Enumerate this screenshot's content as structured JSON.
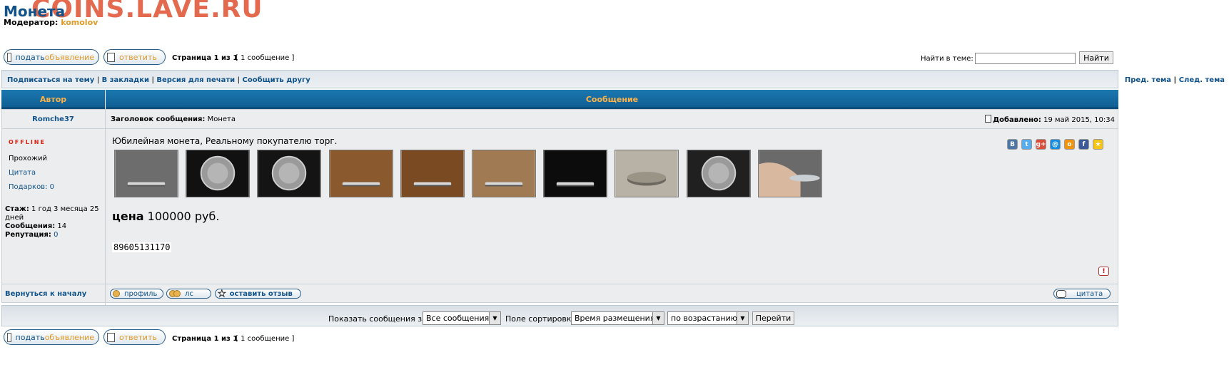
{
  "forum": {
    "title": "Монета",
    "watermark": "COINS.LAVE.RU",
    "moderator_label": "Модератор:",
    "moderator_name": "komolov"
  },
  "actions": {
    "new_topic_part1": "подать ",
    "new_topic_part2": "объявление",
    "reply": "ответить"
  },
  "pagination": {
    "page_text": "Страница 1 из 1",
    "count_text": "[ 1 сообщение ]"
  },
  "search": {
    "label": "Найти в теме:",
    "value": "",
    "button": "Найти"
  },
  "topic_nav": {
    "subscribe": "Подписаться на тему",
    "bookmark": "В закладки",
    "print": "Версия для печати",
    "email_friend": "Сообщить другу",
    "prev": "Пред. тема",
    "next": "След. тема",
    "sep": "|"
  },
  "table_header": {
    "author": "Автор",
    "message": "Сообщение"
  },
  "post": {
    "author": "Romche37",
    "subject_label": "Заголовок сообщения:",
    "subject": "Монета",
    "added_label": "Добавлено:",
    "added_date": "19 май 2015, 10:34",
    "status": "OFFLINE",
    "rank": "Прохожий",
    "quote_link": "Цитата",
    "gifts": "Подарков: 0",
    "tenure_label": "Стаж:",
    "tenure_value": "1 год 3 месяца 25 дней",
    "posts_label": "Сообщения:",
    "posts_value": "14",
    "reputation_label": "Репутация:",
    "reputation_value": "0",
    "body": "Юбилейная монета, Реальному покупателю торг.",
    "price_label": "цена",
    "price_value": "100000 руб.",
    "phone": "89605131170",
    "report": "!",
    "thumbnails": [
      {
        "bg": "#6d6d6d",
        "kind": "edge"
      },
      {
        "bg": "#111111",
        "kind": "face"
      },
      {
        "bg": "#141414",
        "kind": "face"
      },
      {
        "bg": "#8a5a2e",
        "kind": "edge"
      },
      {
        "bg": "#7a4a22",
        "kind": "edge"
      },
      {
        "bg": "#a07a52",
        "kind": "edge"
      },
      {
        "bg": "#0c0c0c",
        "kind": "edge"
      },
      {
        "bg": "#b8b2a6",
        "kind": "tilt"
      },
      {
        "bg": "#202020",
        "kind": "face"
      },
      {
        "bg": "#6a6a6a",
        "kind": "hand"
      }
    ],
    "share": [
      {
        "letter": "В",
        "color": "#4a76a8",
        "name": "vk-icon"
      },
      {
        "letter": "t",
        "color": "#55acee",
        "name": "twitter-icon"
      },
      {
        "letter": "g+",
        "color": "#dd4b39",
        "name": "googleplus-icon"
      },
      {
        "letter": "@",
        "color": "#168de2",
        "name": "mailru-icon"
      },
      {
        "letter": "о",
        "color": "#f2930d",
        "name": "odnoklassniki-icon"
      },
      {
        "letter": "f",
        "color": "#3b5998",
        "name": "facebook-icon"
      },
      {
        "letter": "★",
        "color": "#f5c518",
        "name": "favorite-icon"
      }
    ]
  },
  "post_buttons": {
    "profile": "профиль",
    "pm": "лс",
    "review": "оставить отзыв",
    "quote": "цитата",
    "back_to_top": "Вернуться к началу"
  },
  "sort": {
    "show_label": "Показать сообщения за:",
    "show_value": "Все сообщения",
    "sort_label": "Поле сортировки",
    "sort_value": "Время размещения",
    "order_value": "по возрастанию",
    "go": "Перейти"
  }
}
